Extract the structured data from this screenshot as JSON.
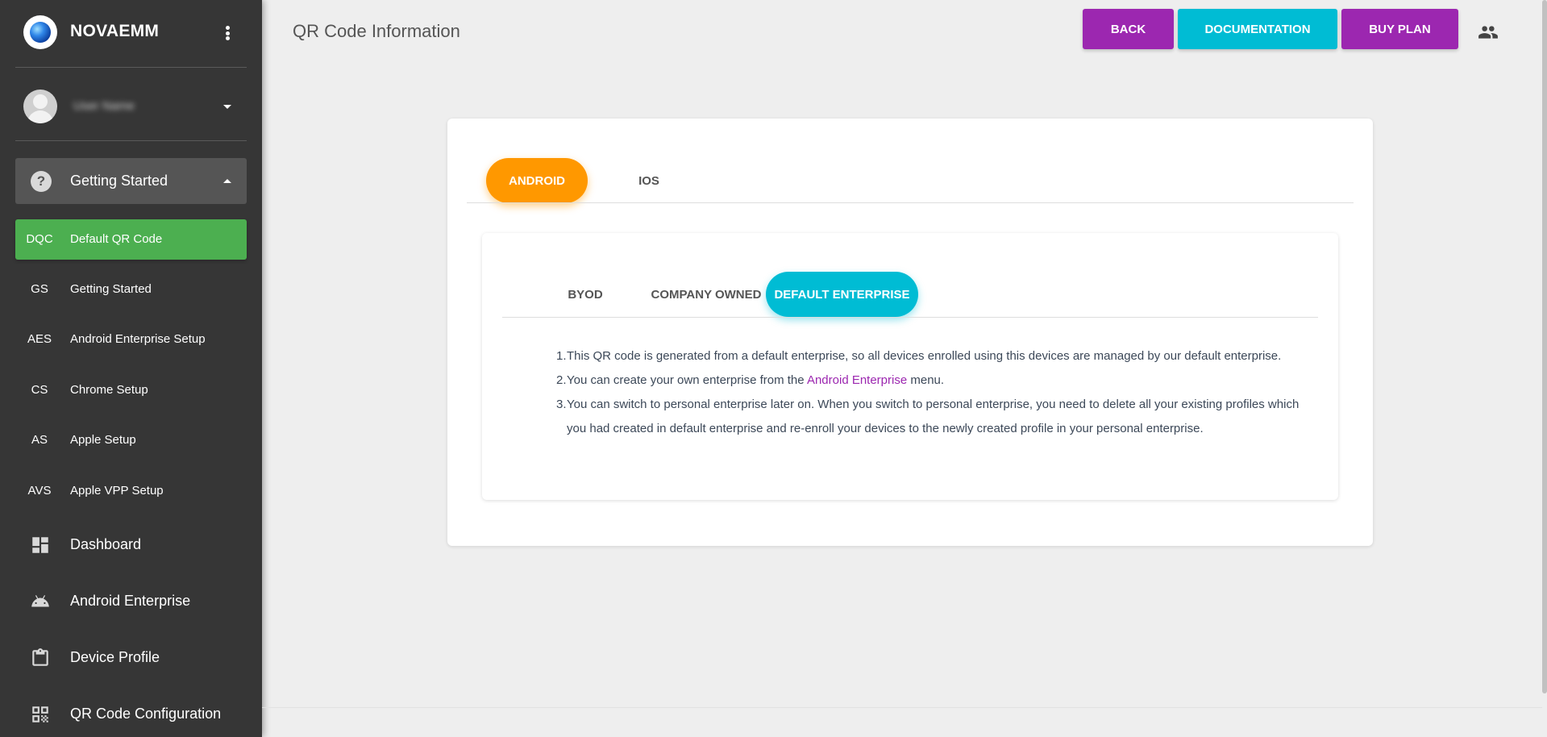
{
  "sidebar": {
    "brand": "NOVAEMM",
    "user_name": "User Name",
    "section": {
      "label": "Getting Started"
    },
    "sub_items": [
      {
        "abbr": "DQC",
        "label": "Default QR Code"
      },
      {
        "abbr": "GS",
        "label": "Getting Started"
      },
      {
        "abbr": "AES",
        "label": "Android Enterprise Setup"
      },
      {
        "abbr": "CS",
        "label": "Chrome Setup"
      },
      {
        "abbr": "AS",
        "label": "Apple Setup"
      },
      {
        "abbr": "AVS",
        "label": "Apple VPP Setup"
      }
    ],
    "main_items": [
      {
        "label": "Dashboard",
        "icon": "dashboard-icon"
      },
      {
        "label": "Android Enterprise",
        "icon": "android-icon"
      },
      {
        "label": "Device Profile",
        "icon": "clipboard-icon"
      },
      {
        "label": "QR Code Configuration",
        "icon": "qr-code-icon"
      }
    ]
  },
  "header": {
    "title": "QR Code Information",
    "buttons": {
      "back": "BACK",
      "documentation": "DOCUMENTATION",
      "buy_plan": "BUY PLAN"
    }
  },
  "platform_tabs": [
    "ANDROID",
    "IOS"
  ],
  "enrollment_tabs": [
    "BYOD",
    "COMPANY OWNED",
    "DEFAULT ENTERPRISE"
  ],
  "content": {
    "step1": {
      "num": "1.",
      "text": "This QR code is generated from a default enterprise, so all devices enrolled using this devices are managed by our default enterprise."
    },
    "step2": {
      "num": "2.",
      "before": "You can create your own enterprise from the ",
      "link": "Android Enterprise",
      "after": " menu."
    },
    "step3": {
      "num": "3.",
      "text": "You can switch to personal enterprise later on. When you switch to personal enterprise, you need to delete all your existing profiles which you had created in default enterprise and re-enroll your devices to the newly created profile in your personal enterprise."
    }
  },
  "colors": {
    "purple": "#9c27b0",
    "cyan": "#00bcd4",
    "orange": "#ff9800",
    "green": "#4caf50",
    "sidebar": "#363636"
  }
}
